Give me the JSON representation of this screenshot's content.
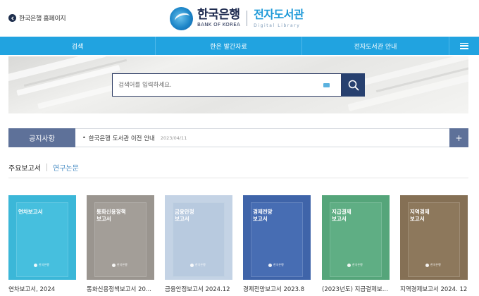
{
  "header": {
    "home_link": "한국은행 홈페이지",
    "logo_ko": "한국은행",
    "logo_en": "BANK OF KOREA",
    "library_ko": "전자도서관",
    "library_en": "Digital Library"
  },
  "nav": {
    "items": [
      "검색",
      "한은 발간자료",
      "전자도서관 안내"
    ]
  },
  "search": {
    "placeholder": "검색어를 입력하세요."
  },
  "notice": {
    "label": "공지사항",
    "bullet": "•",
    "text": "한국은행 도서관 이전 안내",
    "date": "2023/04/11",
    "plus": "+"
  },
  "tabs": [
    "주요보고서",
    "연구논문"
  ],
  "books": [
    {
      "cover_title": "연차보고서",
      "caption": "연차보고서, 2024",
      "emblem": "한국은행",
      "color": "#3bb7d8",
      "inner": "#46bfde"
    },
    {
      "cover_title": "통화신용정책\n보고서",
      "caption": "통화신용정책보고서 20...",
      "emblem": "한국은행",
      "color": "#9a958f",
      "inner": "#a39e98"
    },
    {
      "cover_title": "금융안정\n보고서",
      "caption": "금융안정보고서 2024.12",
      "emblem": "한국은행",
      "color": "#c4d3e5",
      "inner": "#b8cadf"
    },
    {
      "cover_title": "경제전망\n보고서",
      "caption": "경제전망보고서 2023.8",
      "emblem": "한국은행",
      "color": "#3f64a9",
      "inner": "#476db3"
    },
    {
      "cover_title": "지급결제\n보고서",
      "caption": "(2023년도) 지급결제보...",
      "emblem": "한국은행",
      "color": "#55a57a",
      "inner": "#5fae84"
    },
    {
      "cover_title": "지역경제\n보고서",
      "caption": "지역경제보고서 2024. 12",
      "emblem": "한국은행",
      "color": "#857055",
      "inner": "#8d785c"
    }
  ]
}
